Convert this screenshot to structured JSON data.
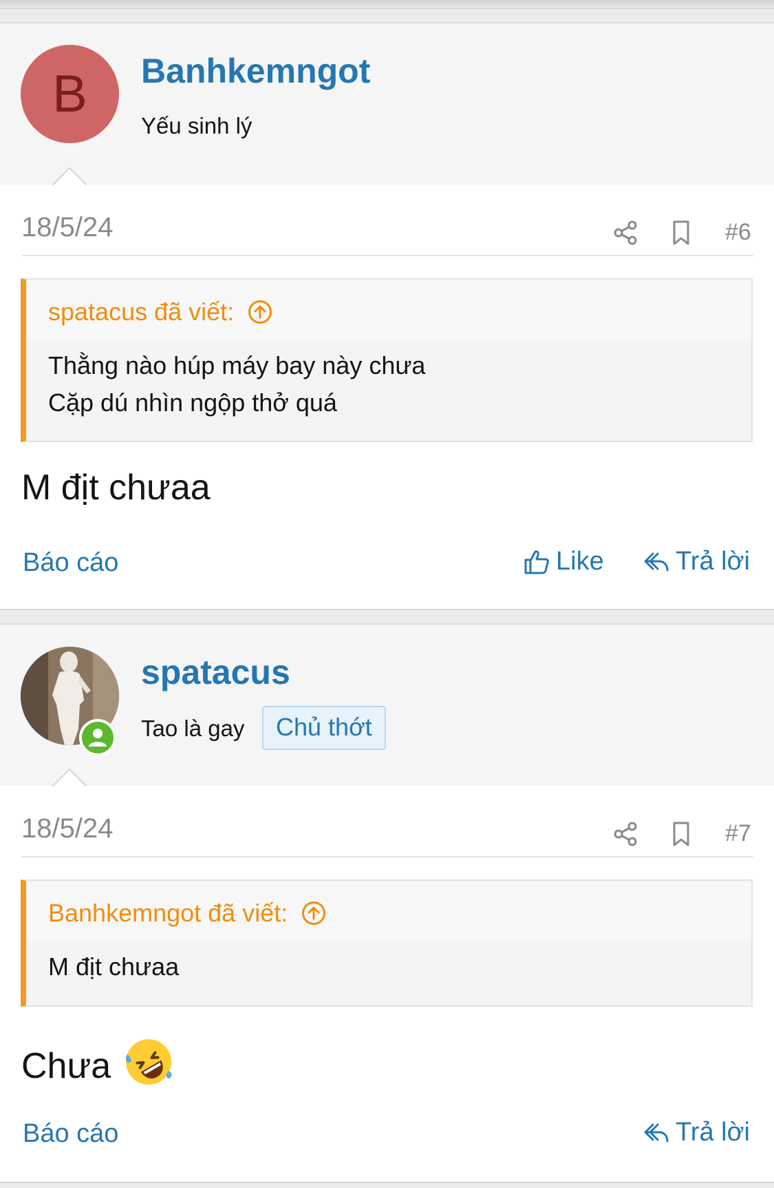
{
  "posts": [
    {
      "author": "Banhkemngot",
      "avatar_letter": "B",
      "user_title": "Yếu sinh lý",
      "date": "18/5/24",
      "post_number": "#6",
      "quote": {
        "author_label": "spatacus đã viết:",
        "lines": [
          "Thằng nào húp máy bay này chưa",
          "Cặp dú nhìn ngộp thở quá"
        ]
      },
      "message": "M địt chưaa",
      "actions": {
        "report": "Báo cáo",
        "like": "Like",
        "reply": "Trả lời"
      }
    },
    {
      "author": "spatacus",
      "user_title": "Tao là gay",
      "badge": "Chủ thớt",
      "date": "18/5/24",
      "post_number": "#7",
      "quote": {
        "author_label": "Banhkemngot đã viết:",
        "lines": [
          "M địt chưaa"
        ]
      },
      "message": "Chưa",
      "message_emoji": "rolling-on-floor-laughing-emoji",
      "actions": {
        "report": "Báo cáo",
        "reply": "Trả lời"
      }
    }
  ],
  "colors": {
    "link": "#2577b1",
    "quote_accent": "#f29a1f",
    "avatar_bg": "#cf6666",
    "online": "#5cb82e"
  },
  "icons": [
    "share-icon",
    "bookmark-icon",
    "arrow-up-circle-icon",
    "thumbs-up-icon",
    "reply-icon",
    "online-user-icon"
  ]
}
